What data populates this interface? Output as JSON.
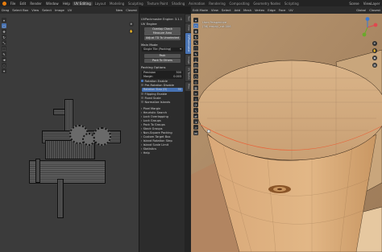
{
  "topbar": {
    "menus": [
      "File",
      "Edit",
      "Render",
      "Window",
      "Help"
    ],
    "tabs": [
      {
        "label": "UV Editing",
        "active": true
      },
      {
        "label": "Layout",
        "active": false
      },
      {
        "label": "Modeling",
        "active": false
      },
      {
        "label": "Sculpting",
        "active": false
      },
      {
        "label": "Texture Paint",
        "active": false
      },
      {
        "label": "Shading",
        "active": false
      },
      {
        "label": "Animation",
        "active": false
      },
      {
        "label": "Rendering",
        "active": false
      },
      {
        "label": "Compositing",
        "active": false
      },
      {
        "label": "Geometry Nodes",
        "active": false
      },
      {
        "label": "Scripting",
        "active": false
      }
    ],
    "scene": "Scene",
    "viewlayer": "ViewLayer"
  },
  "uv_header": {
    "items": [
      "Drag",
      "Select Box",
      "View",
      "Select",
      "Image",
      "UV"
    ],
    "image_name": "New",
    "snap": "Closest"
  },
  "npanel": {
    "engine": "UVPackmaster Engine: 3.1.1",
    "section_main": "UV Engine",
    "buttons_top": [
      "Overlap Check",
      "Measure Area",
      "Adjust TD To Unselected"
    ],
    "section_mode": "Main Mode",
    "mode_value": "Single Tile (Packing)",
    "pack_btn": "Pack",
    "pack_to_others": "Pack To Others",
    "section_packing": "Packing Options",
    "precision_label": "Precision",
    "precision_value": "500",
    "margin_label": "Margin",
    "margin_value": "0.003",
    "rotation_enable": "Rotation Enable",
    "prerotation": "Pre-Rotation Disable",
    "rotation_step_label": "Rotation Step (D)",
    "rotation_step_value": "90",
    "flipping": "Flipping Enable",
    "fixed_scale": "Fixed Scale",
    "normalize": "Normalize Islands",
    "subpanels": [
      "Pixel Margin",
      "Heuristic Search",
      "Lock Overlapping",
      "Lock Groups",
      "Pack To Groups",
      "Stack Groups",
      "Non-Square Packing",
      "Custom Target Box",
      "Island Rotation Step",
      "Island Scale Limit",
      "Statistics",
      "Help"
    ]
  },
  "vtabs": [
    "Tool",
    "View",
    "UVPackmaster",
    "Image",
    "UV Toolkit",
    "Misc"
  ],
  "v3d_header": {
    "mode": "Edit Mode",
    "items": [
      "View",
      "Select",
      "Add",
      "Mesh",
      "Vertex",
      "Edge",
      "Face",
      "UV"
    ],
    "transform": "Global",
    "snap": "Closest"
  },
  "v3d_overlay": {
    "view": "User Perspective",
    "object": "(36) empty_cut.006"
  },
  "colors": {
    "accent": "#4772b3",
    "wood": "#c99a66",
    "edge": "#e8643a"
  }
}
